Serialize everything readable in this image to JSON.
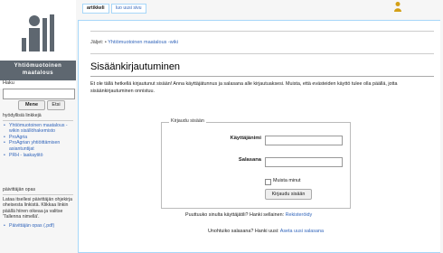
{
  "sidebar": {
    "logo_text_line1": "Yhtiömuotoinen",
    "logo_text_line2": "maatalous",
    "haku_label": "Haku",
    "search_placeholder": "",
    "menu_button": "Mene",
    "search_button": "Etsi",
    "useful_links_head": "hyödyllisiä linkkejä",
    "useful_links": [
      "Yhtiömuotoinen maatalous -wikin sisällöhakemisto",
      "ProAgria",
      "ProAgrian yhtiöittämisen asiantuntijat",
      "PRH - laakaytitö"
    ],
    "guide_head": "päivittäjän opas",
    "guide_text": "Lataa itsellesi päivittäjän ohjekirja oheisesta linkistä. Klikkaa linkin päällä hiiren oikeaa ja valitse 'Tallenna nimellä'.",
    "guide_link": "Päivittäjän opas (.pdf)"
  },
  "tabs": [
    {
      "label": "artikkeli"
    },
    {
      "label": "luo uusi sivu"
    }
  ],
  "breadcrumb": {
    "prefix": "Jäljet:",
    "link": "Yhtiömuotoinen maatalous -wiki"
  },
  "page": {
    "title": "Sisäänkirjautuminen",
    "intro": "Et ole tällä hetkellä kirjautunut sisään! Anna käyttäjätunnus ja salasana alle kirjautuaksesi. Muista, että evästeiden käyttö tulee olla päällä, jotta sisäänkirjautuminen onnistuu."
  },
  "login": {
    "legend": "Kirjaudu sisään",
    "username_label": "Käyttäjänimi",
    "username_value": "",
    "password_label": "Salasana",
    "password_value": "",
    "remember_label": "Muista minut",
    "remember_checked": false,
    "submit_label": "Kirjaudu sisään"
  },
  "register_line": {
    "text": "Puuttuuko sinulta käyttäjätili? Hanki sellainen:",
    "link": "Rekisteröidy"
  },
  "forgot_line": {
    "text": "Unohtuiko salasana? Hanki uusi:",
    "link": "Aseta uusi salasana"
  },
  "icons": {
    "logo": "farmer-figure-logo",
    "user": "user-icon"
  },
  "colors": {
    "link": "#3366bb",
    "tab_border": "#a7d7f9",
    "logo_band": "#5e6770"
  }
}
